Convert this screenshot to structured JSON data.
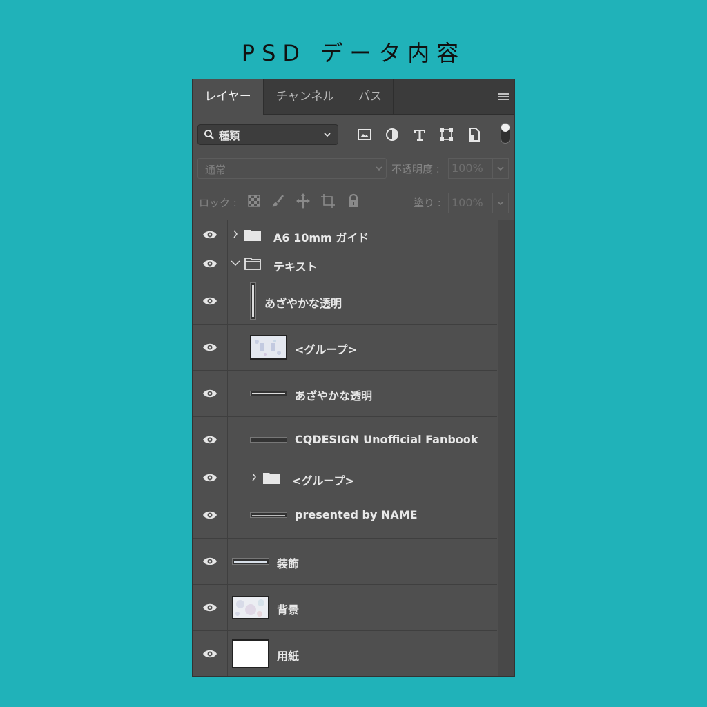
{
  "page_title": "PSD データ内容",
  "tabs": [
    {
      "label": "レイヤー",
      "active": true
    },
    {
      "label": "チャンネル",
      "active": false
    },
    {
      "label": "パス",
      "active": false
    }
  ],
  "filter": {
    "kind_label": "種類",
    "icons": [
      "image-filter-icon",
      "adjustment-filter-icon",
      "type-filter-icon",
      "shape-filter-icon",
      "smart-object-filter-icon"
    ]
  },
  "blend": {
    "mode": "通常",
    "opacity_label": "不透明度 :",
    "opacity_value": "100%"
  },
  "lock": {
    "label": "ロック :",
    "fill_label": "塗り :",
    "fill_value": "100%"
  },
  "layers": [
    {
      "name": "A6 10mm ガイド",
      "type": "group",
      "expanded": false
    },
    {
      "name": "テキスト",
      "type": "group",
      "expanded": true
    },
    {
      "name": "あざやかな透明",
      "type": "text-vertical"
    },
    {
      "name": "<グループ>",
      "type": "smart-object"
    },
    {
      "name": "あざやかな透明",
      "type": "text"
    },
    {
      "name": "CQDESIGN Unofficial Fanbook",
      "type": "text"
    },
    {
      "name": "<グループ>",
      "type": "group",
      "expanded": false
    },
    {
      "name": "presented by NAME",
      "type": "text"
    },
    {
      "name": "装飾",
      "type": "text"
    },
    {
      "name": "背景",
      "type": "image"
    },
    {
      "name": "用紙",
      "type": "fill"
    }
  ],
  "colors": {
    "background": "#20b2b9",
    "panel": "#4f4f4f",
    "tabbar": "#3b3b3b"
  }
}
